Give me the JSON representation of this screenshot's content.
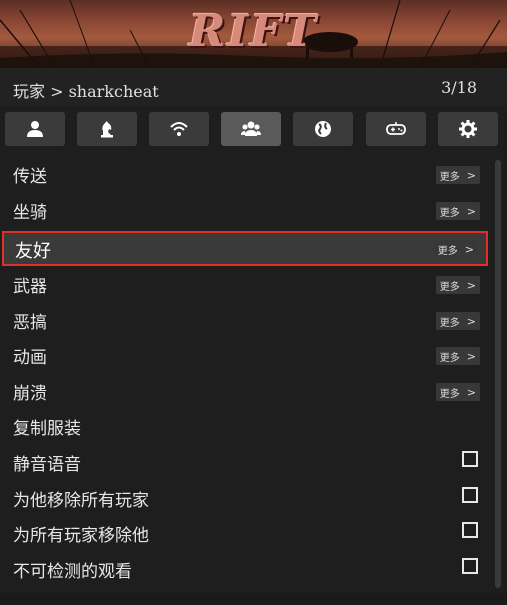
{
  "banner": {
    "logo_text": "RIFT"
  },
  "header": {
    "breadcrumb": "玩家 > sharkcheat",
    "page_indicator": "3/18"
  },
  "tabs": [
    {
      "icon": "user-icon",
      "active": false
    },
    {
      "icon": "chess-knight-icon",
      "active": false
    },
    {
      "icon": "wifi-icon",
      "active": false
    },
    {
      "icon": "users-icon",
      "active": true
    },
    {
      "icon": "globe-icon",
      "active": false
    },
    {
      "icon": "gamepad-icon",
      "active": false
    },
    {
      "icon": "gear-icon",
      "active": false
    }
  ],
  "more_label": "更多",
  "more_arrow": ">",
  "items": [
    {
      "label": "传送",
      "type": "submenu"
    },
    {
      "label": "坐骑",
      "type": "submenu"
    },
    {
      "label": "友好",
      "type": "submenu",
      "selected": true
    },
    {
      "label": "武器",
      "type": "submenu"
    },
    {
      "label": "恶搞",
      "type": "submenu"
    },
    {
      "label": "动画",
      "type": "submenu"
    },
    {
      "label": "崩溃",
      "type": "submenu"
    },
    {
      "label": "复制服装",
      "type": "action"
    },
    {
      "label": "静音语音",
      "type": "checkbox",
      "checked": false
    },
    {
      "label": "为他移除所有玩家",
      "type": "checkbox",
      "checked": false
    },
    {
      "label": "为所有玩家移除他",
      "type": "checkbox",
      "checked": false
    },
    {
      "label": "不可检测的观看",
      "type": "checkbox",
      "checked": false
    }
  ],
  "colors": {
    "highlight_border": "#e0302a",
    "panel_bg": "#1e1e1e"
  }
}
